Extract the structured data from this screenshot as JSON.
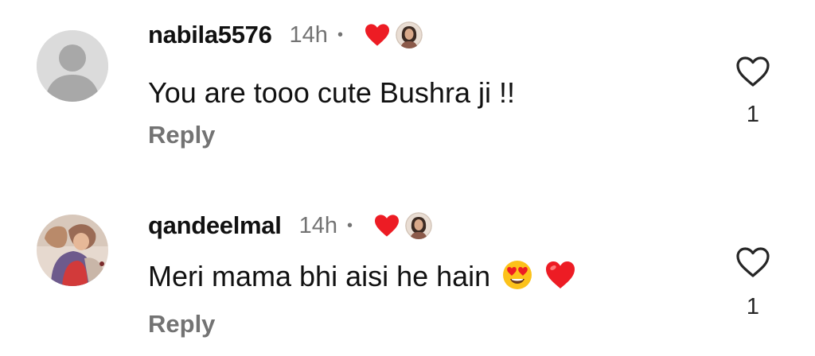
{
  "comments": [
    {
      "username": "nabila5576",
      "time": "14h",
      "separator": "•",
      "text": "You are tooo cute Bushra ji !!",
      "emojis": [],
      "reply_label": "Reply",
      "like_count": "1",
      "avatar": "default-person-avatar",
      "creator_liked_icon": "red-heart-icon"
    },
    {
      "username": "qandeelmal",
      "time": "14h",
      "separator": "•",
      "text": "Meri mama bhi aisi he hain",
      "emojis": [
        "heart-eyes-emoji",
        "red-heart-emoji"
      ],
      "reply_label": "Reply",
      "like_count": "1",
      "avatar": "photo-avatar",
      "creator_liked_icon": "red-heart-icon"
    }
  ],
  "colors": {
    "text_primary": "#111111",
    "text_secondary": "#737373",
    "like_red": "#ed1c24",
    "default_avatar_bg": "#dbdbdb",
    "default_avatar_fg": "#a8a8a8"
  }
}
